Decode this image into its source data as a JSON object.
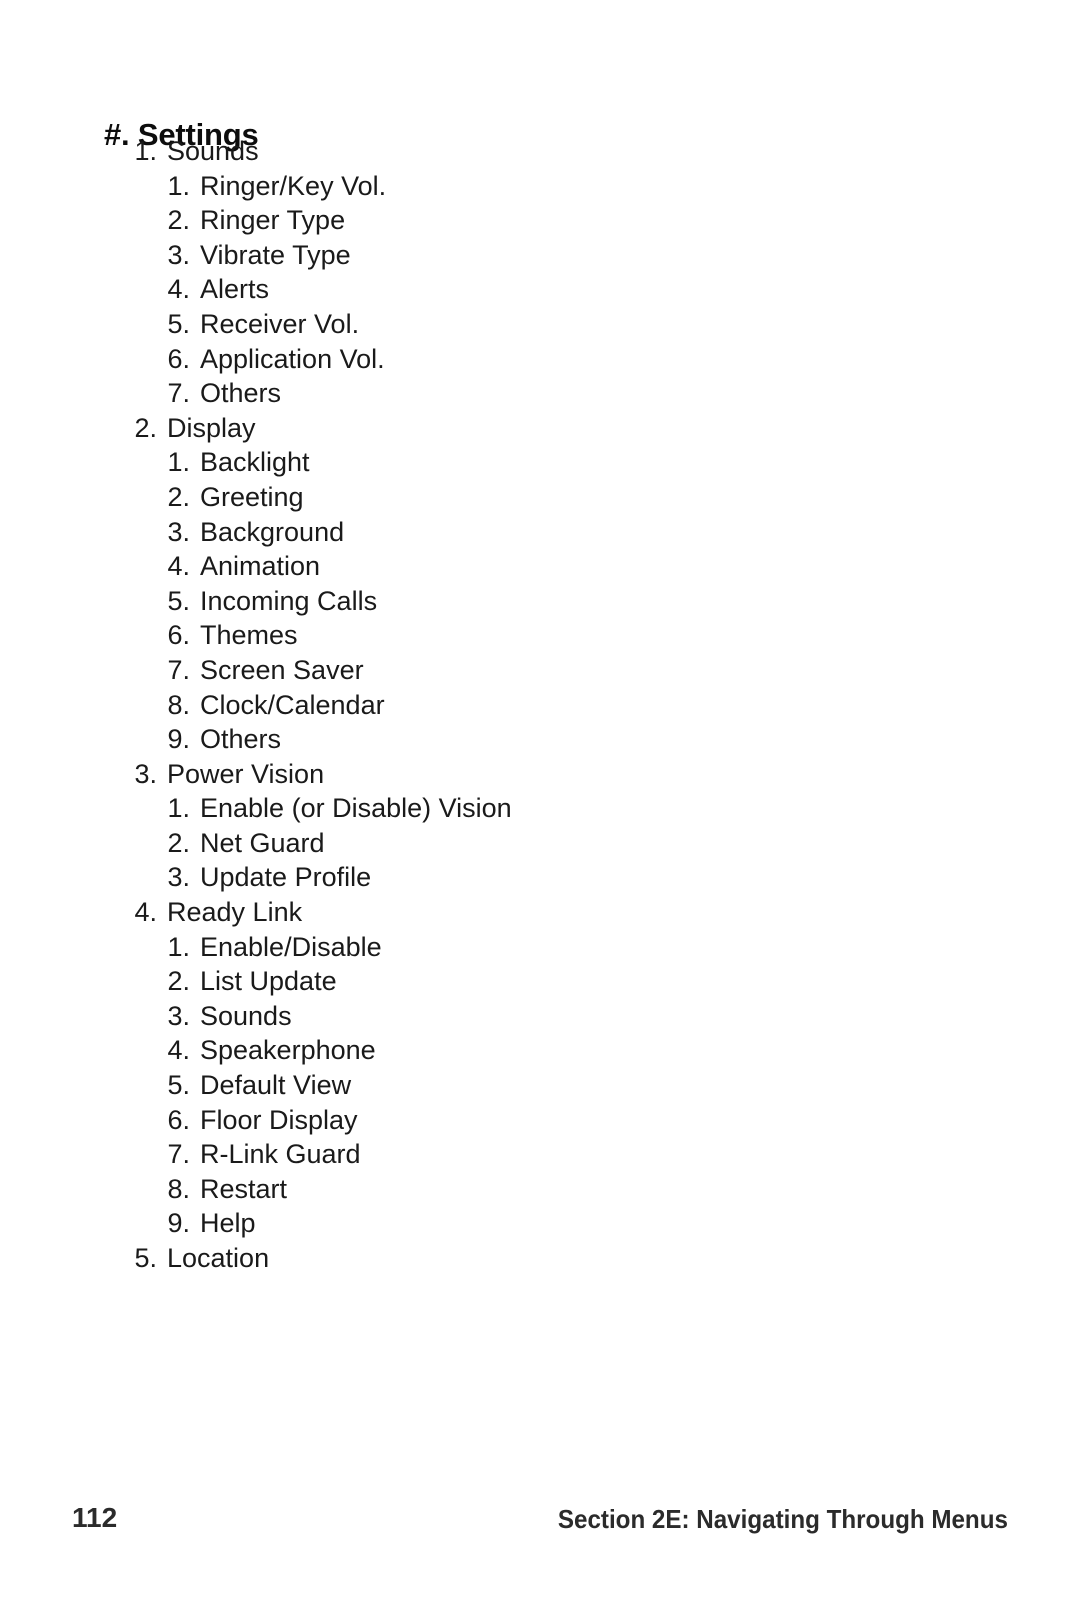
{
  "document": {
    "heading": "#. Settings",
    "outline": [
      {
        "level": 1,
        "num": "1.",
        "label": "Sounds"
      },
      {
        "level": 2,
        "num": "1.",
        "label": "Ringer/Key Vol."
      },
      {
        "level": 2,
        "num": "2.",
        "label": "Ringer Type"
      },
      {
        "level": 2,
        "num": "3.",
        "label": "Vibrate Type"
      },
      {
        "level": 2,
        "num": "4.",
        "label": "Alerts"
      },
      {
        "level": 2,
        "num": "5.",
        "label": "Receiver Vol."
      },
      {
        "level": 2,
        "num": "6.",
        "label": "Application Vol."
      },
      {
        "level": 2,
        "num": "7.",
        "label": "Others"
      },
      {
        "level": 1,
        "num": "2.",
        "label": "Display"
      },
      {
        "level": 2,
        "num": "1.",
        "label": "Backlight"
      },
      {
        "level": 2,
        "num": "2.",
        "label": "Greeting"
      },
      {
        "level": 2,
        "num": "3.",
        "label": "Background"
      },
      {
        "level": 2,
        "num": "4.",
        "label": "Animation"
      },
      {
        "level": 2,
        "num": "5.",
        "label": "Incoming Calls"
      },
      {
        "level": 2,
        "num": "6.",
        "label": "Themes"
      },
      {
        "level": 2,
        "num": "7.",
        "label": "Screen Saver"
      },
      {
        "level": 2,
        "num": "8.",
        "label": "Clock/Calendar"
      },
      {
        "level": 2,
        "num": "9.",
        "label": "Others"
      },
      {
        "level": 1,
        "num": "3.",
        "label": "Power Vision"
      },
      {
        "level": 2,
        "num": "1.",
        "label": "Enable (or Disable) Vision"
      },
      {
        "level": 2,
        "num": "2.",
        "label": "Net Guard"
      },
      {
        "level": 2,
        "num": "3.",
        "label": "Update Profile"
      },
      {
        "level": 1,
        "num": "4.",
        "label": "Ready Link"
      },
      {
        "level": 2,
        "num": "1.",
        "label": "Enable/Disable"
      },
      {
        "level": 2,
        "num": "2.",
        "label": "List Update"
      },
      {
        "level": 2,
        "num": "3.",
        "label": "Sounds"
      },
      {
        "level": 2,
        "num": "4.",
        "label": "Speakerphone"
      },
      {
        "level": 2,
        "num": "5.",
        "label": "Default View"
      },
      {
        "level": 2,
        "num": "6.",
        "label": "Floor Display"
      },
      {
        "level": 2,
        "num": "7.",
        "label": "R-Link Guard"
      },
      {
        "level": 2,
        "num": "8.",
        "label": "Restart"
      },
      {
        "level": 2,
        "num": "9.",
        "label": "Help"
      },
      {
        "level": 1,
        "num": "5.",
        "label": "Location"
      }
    ]
  },
  "footer": {
    "page_number": "112",
    "section": "Section 2E: Navigating Through Menus"
  },
  "colors": {
    "background": "#ffffff",
    "text": "#1a1a1a",
    "heading": "#0d0d0d",
    "footer": "#2b2b2b"
  }
}
